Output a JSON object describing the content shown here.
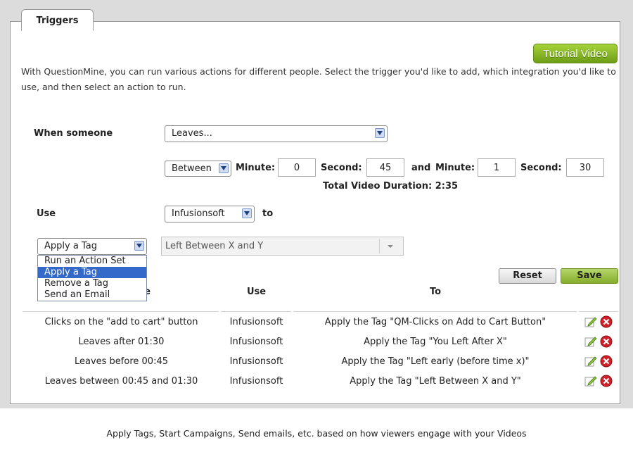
{
  "tab_title": "Triggers",
  "tutorial_button": "Tutorial Video",
  "intro": "With QuestionMine, you can run various actions for different people. Select the trigger you'd like to add, which integration you'd like to use, and then select an action to run.",
  "when_label": "When someone",
  "when_select": "Leaves...",
  "range_select": "Between",
  "minute_label": "Minute:",
  "second_label": "Second:",
  "and_label": "and",
  "minute2_label": "Minute:",
  "second2_label": "Second:",
  "minute_start": "0",
  "second_start": "45",
  "minute_end": "1",
  "second_end": "30",
  "duration": "Total Video Duration: 2:35",
  "use_label": "Use",
  "integration_select": "Infusionsoft",
  "to_label": "to",
  "action_select": "Apply a Tag",
  "tag_select": "Left Between X and Y",
  "action_options": [
    "Run an Action Set",
    "Apply a Tag",
    "Remove a Tag",
    "Send an Email"
  ],
  "selected_option_index": 1,
  "reset_button": "Reset",
  "save_button": "Save",
  "table": {
    "headers": [
      "ne",
      "Use",
      "To"
    ],
    "rows": [
      {
        "when": "Clicks on the \"add to cart\" button",
        "use": "Infusionsoft",
        "to": "Apply the Tag \"QM-Clicks on Add to Cart Button\""
      },
      {
        "when": "Leaves after 01:30",
        "use": "Infusionsoft",
        "to": "Apply the Tag \"You Left After X\""
      },
      {
        "when": "Leaves before 00:45",
        "use": "Infusionsoft",
        "to": "Apply the Tag \"Left early (before time x)\""
      },
      {
        "when": "Leaves between 00:45 and 01:30",
        "use": "Infusionsoft",
        "to": "Apply the Tag \"Left Between X and Y\""
      }
    ]
  },
  "caption": "Apply Tags, Start Campaigns, Send emails, etc. based on how viewers engage with your Videos",
  "icons": {
    "edit": "edit-icon",
    "delete": "delete-icon"
  },
  "colors": {
    "accent_green": "#86ad2c",
    "selected_blue": "#3369c8",
    "delete_red": "#d0202a"
  }
}
